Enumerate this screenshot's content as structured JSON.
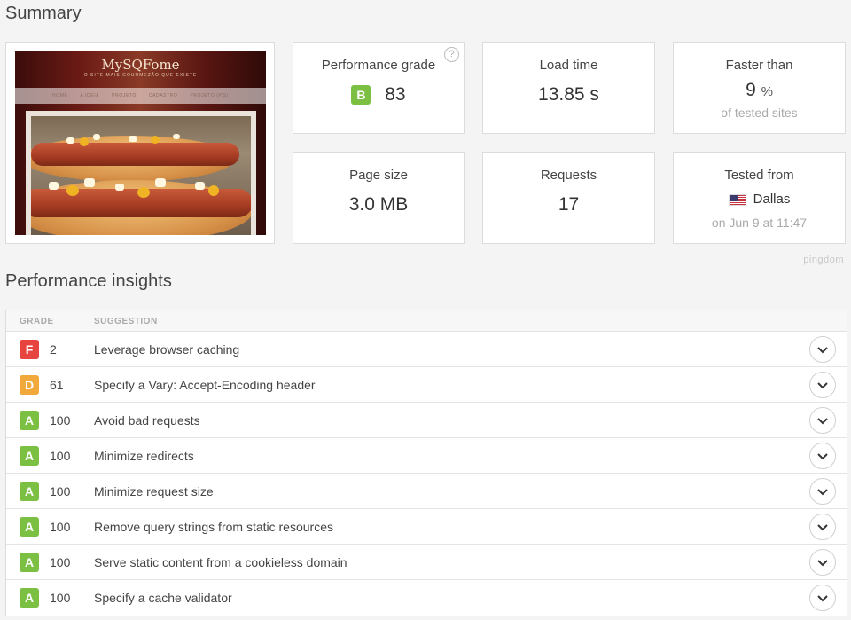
{
  "summary": {
    "title": "Summary"
  },
  "thumbnail": {
    "site_title": "MySQFome",
    "tagline": "O SITE MAIS GOURMEZÃO QUE EXISTE",
    "nav": [
      "HOME",
      "A IDEIA",
      "PROJETO",
      "CADASTRO",
      "PROJETO (P.S)"
    ]
  },
  "cards": {
    "performance": {
      "label": "Performance grade",
      "grade": "B",
      "grade_color": "#7bc043",
      "score": "83",
      "help": "?"
    },
    "load_time": {
      "label": "Load time",
      "value": "13.85 s"
    },
    "faster_than": {
      "label": "Faster than",
      "value": "9",
      "unit": "%",
      "sub": "of tested sites"
    },
    "page_size": {
      "label": "Page size",
      "value": "3.0 MB"
    },
    "requests": {
      "label": "Requests",
      "value": "17"
    },
    "tested_from": {
      "label": "Tested from",
      "location": "Dallas",
      "flag": "us-flag-icon",
      "date": "on Jun 9 at 11:47"
    }
  },
  "branding": {
    "pingdom": "pingdom"
  },
  "insights": {
    "title": "Performance insights",
    "headers": {
      "grade": "GRADE",
      "suggestion": "SUGGESTION"
    },
    "colors": {
      "F": "#e8443f",
      "D": "#f0a93a",
      "A": "#7bc043"
    },
    "rows": [
      {
        "grade": "F",
        "score": "2",
        "suggestion": "Leverage browser caching"
      },
      {
        "grade": "D",
        "score": "61",
        "suggestion": "Specify a Vary: Accept-Encoding header"
      },
      {
        "grade": "A",
        "score": "100",
        "suggestion": "Avoid bad requests"
      },
      {
        "grade": "A",
        "score": "100",
        "suggestion": "Minimize redirects"
      },
      {
        "grade": "A",
        "score": "100",
        "suggestion": "Minimize request size"
      },
      {
        "grade": "A",
        "score": "100",
        "suggestion": "Remove query strings from static resources"
      },
      {
        "grade": "A",
        "score": "100",
        "suggestion": "Serve static content from a cookieless domain"
      },
      {
        "grade": "A",
        "score": "100",
        "suggestion": "Specify a cache validator"
      }
    ]
  }
}
